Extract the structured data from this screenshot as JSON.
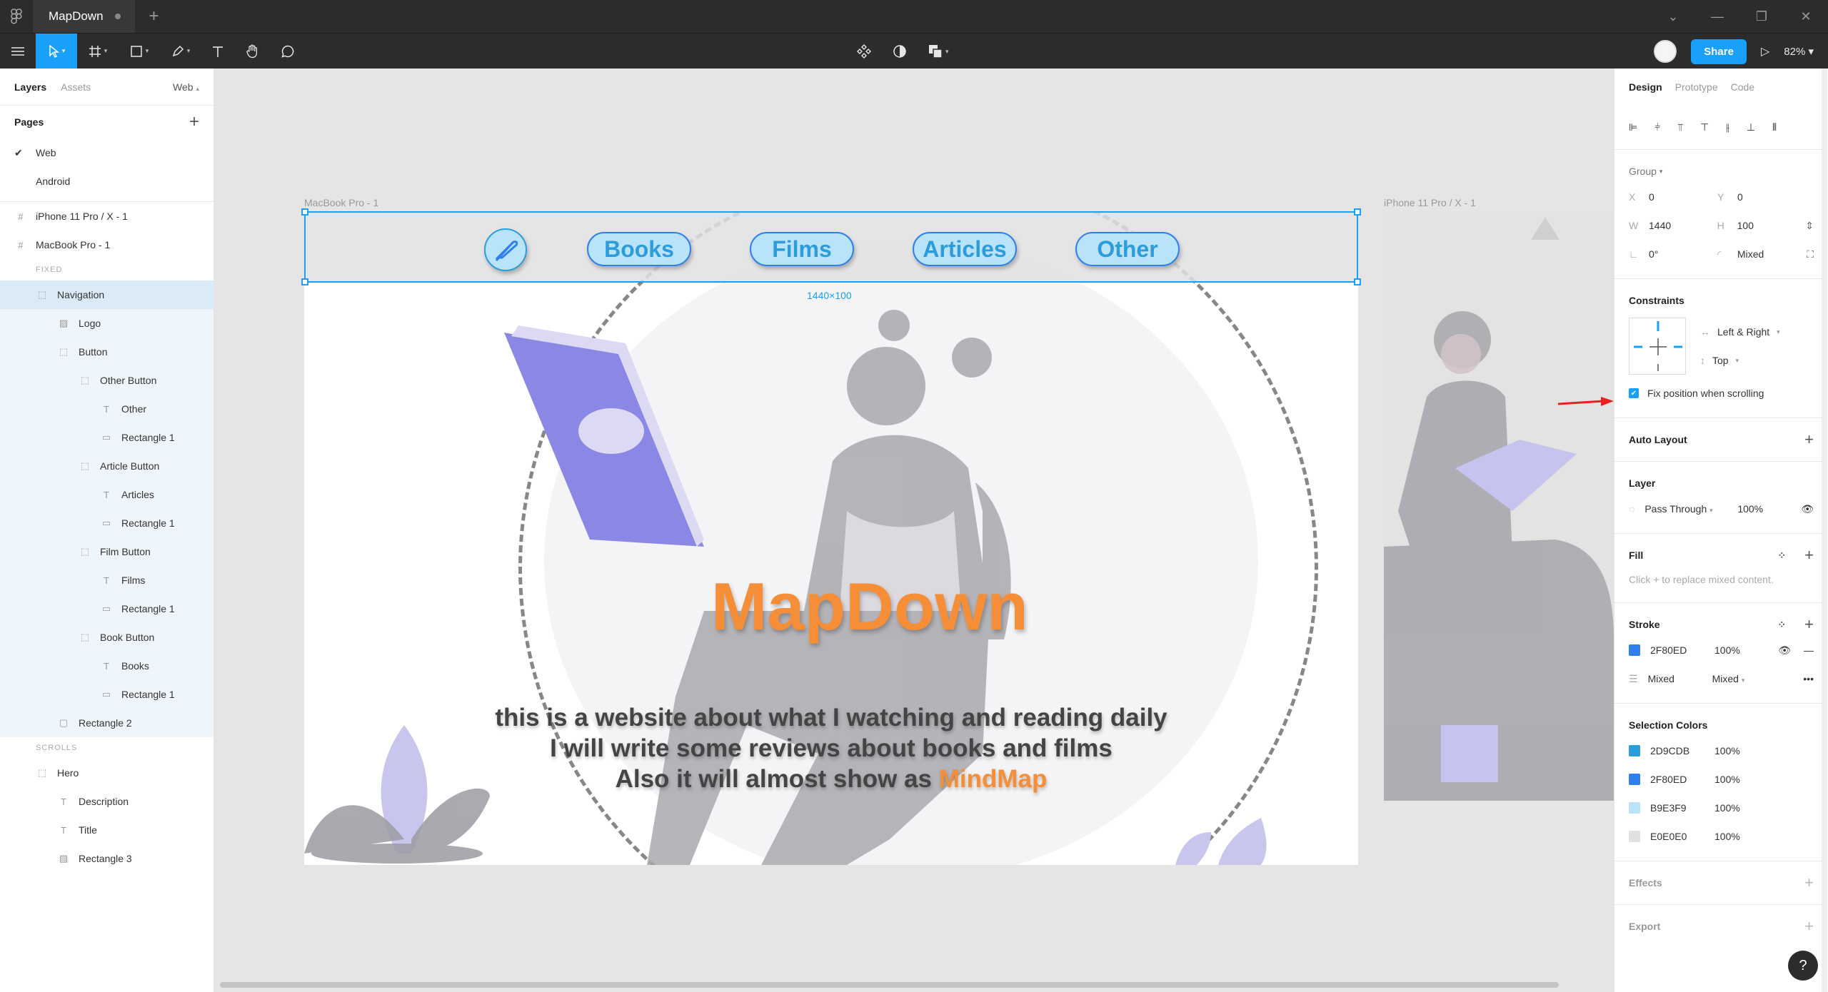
{
  "window": {
    "tab_title": "MapDown"
  },
  "toolbar": {
    "share_label": "Share",
    "zoom": "82%"
  },
  "left": {
    "tab_layers": "Layers",
    "tab_assets": "Assets",
    "page_selector": "Web",
    "pages_heading": "Pages",
    "pages": [
      "Web",
      "Android"
    ],
    "frames": [
      "iPhone 11 Pro / X - 1",
      "MacBook Pro - 1"
    ],
    "section_fixed": "FIXED",
    "section_scrolls": "SCROLLS",
    "layers": {
      "navigation": "Navigation",
      "logo": "Logo",
      "button": "Button",
      "other_button": "Other Button",
      "other": "Other",
      "rect1a": "Rectangle 1",
      "article_button": "Article Button",
      "articles": "Articles",
      "rect1b": "Rectangle 1",
      "film_button": "Film Button",
      "films": "Films",
      "rect1c": "Rectangle 1",
      "book_button": "Book Button",
      "books": "Books",
      "rect1d": "Rectangle 1",
      "rect2": "Rectangle 2",
      "hero": "Hero",
      "description": "Description",
      "title": "Title",
      "rect3": "Rectangle 3"
    }
  },
  "canvas": {
    "frame1_label": "MacBook Pro - 1",
    "frame2_label": "iPhone 11 Pro / X - 1",
    "size_label": "1440×100",
    "nav_buttons": [
      "Books",
      "Films",
      "Articles",
      "Other"
    ],
    "hero_title": "MapDown",
    "hero_line1": "this is a website about what I watching and reading daily",
    "hero_line2": "I will write some reviews about books and films",
    "hero_line3_pre": "Also it will almost show as ",
    "hero_line3_accent": "MindMap"
  },
  "right": {
    "tab_design": "Design",
    "tab_prototype": "Prototype",
    "tab_code": "Code",
    "group_label": "Group",
    "x": "0",
    "y": "0",
    "w": "1440",
    "h": "100",
    "rotation": "0°",
    "radius": "Mixed",
    "constraints_title": "Constraints",
    "constraint_h": "Left & Right",
    "constraint_v": "Top",
    "fix_position": "Fix position when scrolling",
    "auto_layout": "Auto Layout",
    "layer_title": "Layer",
    "blend": "Pass Through",
    "layer_opacity": "100%",
    "fill_title": "Fill",
    "fill_hint": "Click + to replace mixed content.",
    "stroke_title": "Stroke",
    "stroke_hex": "2F80ED",
    "stroke_opacity": "100%",
    "stroke_weight": "Mixed",
    "stroke_align": "Mixed",
    "selection_colors_title": "Selection Colors",
    "selection_colors": [
      {
        "hex": "2D9CDB",
        "opacity": "100%",
        "color": "#2d9cdb"
      },
      {
        "hex": "2F80ED",
        "opacity": "100%",
        "color": "#2f80ed"
      },
      {
        "hex": "B9E3F9",
        "opacity": "100%",
        "color": "#b9e3f9"
      },
      {
        "hex": "E0E0E0",
        "opacity": "100%",
        "color": "#e0e0e0"
      }
    ],
    "effects_title": "Effects",
    "export_title": "Export"
  },
  "colors": {
    "accent": "#18a0fb",
    "brand_orange": "#f58e36",
    "nav_blue": "#2d9cdb"
  }
}
